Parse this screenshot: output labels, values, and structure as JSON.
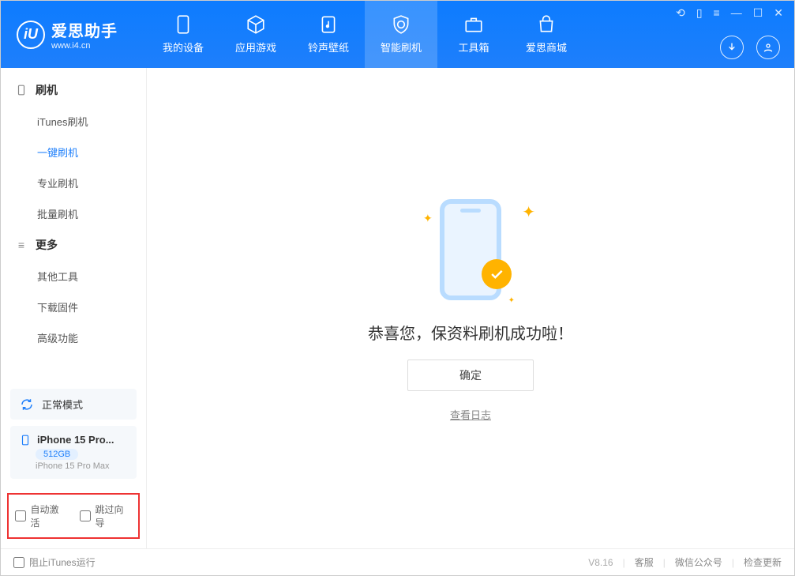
{
  "app": {
    "name": "爱思助手",
    "url": "www.i4.cn"
  },
  "nav": {
    "my_device": "我的设备",
    "apps_games": "应用游戏",
    "ringtones": "铃声壁纸",
    "smart_flash": "智能刷机",
    "toolbox": "工具箱",
    "store": "爱思商城"
  },
  "sidebar": {
    "flash_cat": "刷机",
    "items_flash": {
      "itunes": "iTunes刷机",
      "onekey": "一键刷机",
      "pro": "专业刷机",
      "batch": "批量刷机"
    },
    "more_cat": "更多",
    "items_more": {
      "other_tools": "其他工具",
      "download_fw": "下载固件",
      "advanced": "高级功能"
    },
    "status": "正常模式",
    "device": {
      "name_short": "iPhone 15 Pro...",
      "capacity": "512GB",
      "name_full": "iPhone 15 Pro Max"
    },
    "auto_activate": "自动激活",
    "skip_wizard": "跳过向导"
  },
  "main": {
    "success_text": "恭喜您，保资料刷机成功啦！",
    "confirm": "确定",
    "view_log": "查看日志"
  },
  "footer": {
    "block_itunes": "阻止iTunes运行",
    "version": "V8.16",
    "support": "客服",
    "wechat": "微信公众号",
    "check_update": "检查更新"
  }
}
